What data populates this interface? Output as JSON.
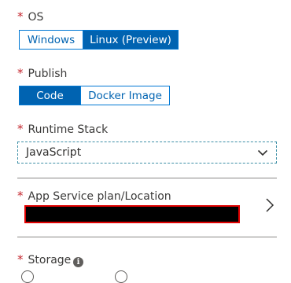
{
  "os": {
    "label": "OS",
    "options": [
      "Windows",
      "Linux (Preview)"
    ],
    "selected": "Linux (Preview)"
  },
  "publish": {
    "label": "Publish",
    "options": [
      "Code",
      "Docker Image"
    ],
    "selected": "Code"
  },
  "runtime_stack": {
    "label": "Runtime Stack",
    "value": "JavaScript"
  },
  "app_service_plan": {
    "label": "App Service plan/Location"
  },
  "storage": {
    "label": "Storage"
  },
  "required_marker": "*",
  "icons": {
    "dropdown": "chevron-down-icon",
    "navigate": "chevron-right-icon",
    "info": "info-icon"
  },
  "colors": {
    "accent": "#0063b1",
    "required": "#c4262e",
    "redaction_fill": "#000000",
    "redaction_border": "#e00000"
  }
}
